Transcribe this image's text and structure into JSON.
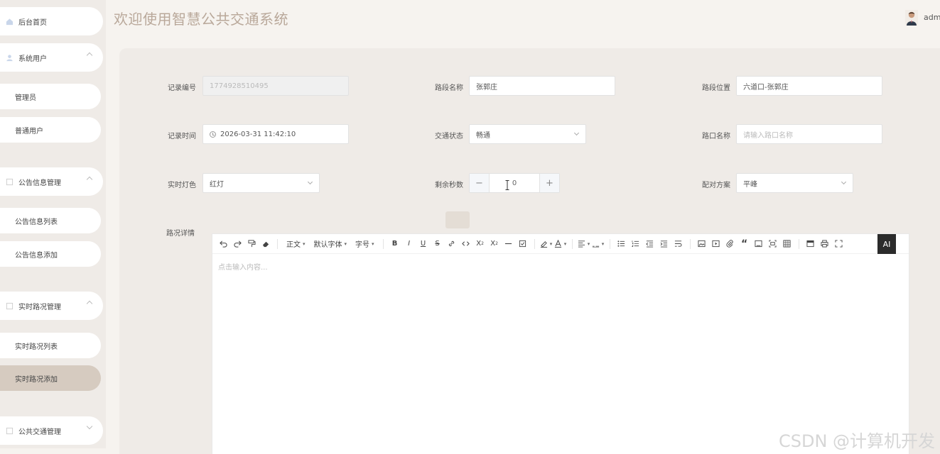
{
  "sidebar": {
    "home": "后台首页",
    "system_users": "系统用户",
    "admin": "管理员",
    "normal_user": "普通用户",
    "notice_mgmt": "公告信息管理",
    "notice_list": "公告信息列表",
    "notice_add": "公告信息添加",
    "traffic_mgmt": "实时路况管理",
    "traffic_list": "实时路况列表",
    "traffic_add": "实时路况添加",
    "transit_mgmt": "公共交通管理"
  },
  "header": {
    "title": "欢迎使用智慧公共交通系统",
    "username": "admin"
  },
  "form": {
    "record_no_label": "记录编号",
    "record_no_value": "1774928510495",
    "road_name_label": "路段名称",
    "road_name_value": "张郭庄",
    "road_pos_label": "路段位置",
    "road_pos_value": "六道口-张郭庄",
    "record_time_label": "记录时间",
    "record_time_value": "2026-03-31 11:42:10",
    "traffic_status_label": "交通状态",
    "traffic_status_value": "畅通",
    "intersection_label": "路口名称",
    "intersection_placeholder": "请输入路口名称",
    "light_label": "实时灯色",
    "light_value": "红灯",
    "remaining_label": "剩余秒数",
    "remaining_value": "0",
    "minus": "−",
    "plus": "+",
    "plan_label": "配对方案",
    "plan_value": "平峰",
    "detail_label": "路况详情"
  },
  "editor": {
    "toolbar": {
      "paragraph": "正文",
      "font_family": "默认字体",
      "font_size": "字号",
      "ai": "AI"
    },
    "placeholder": "点击输入内容..."
  },
  "watermark": "CSDN @计算机开发"
}
